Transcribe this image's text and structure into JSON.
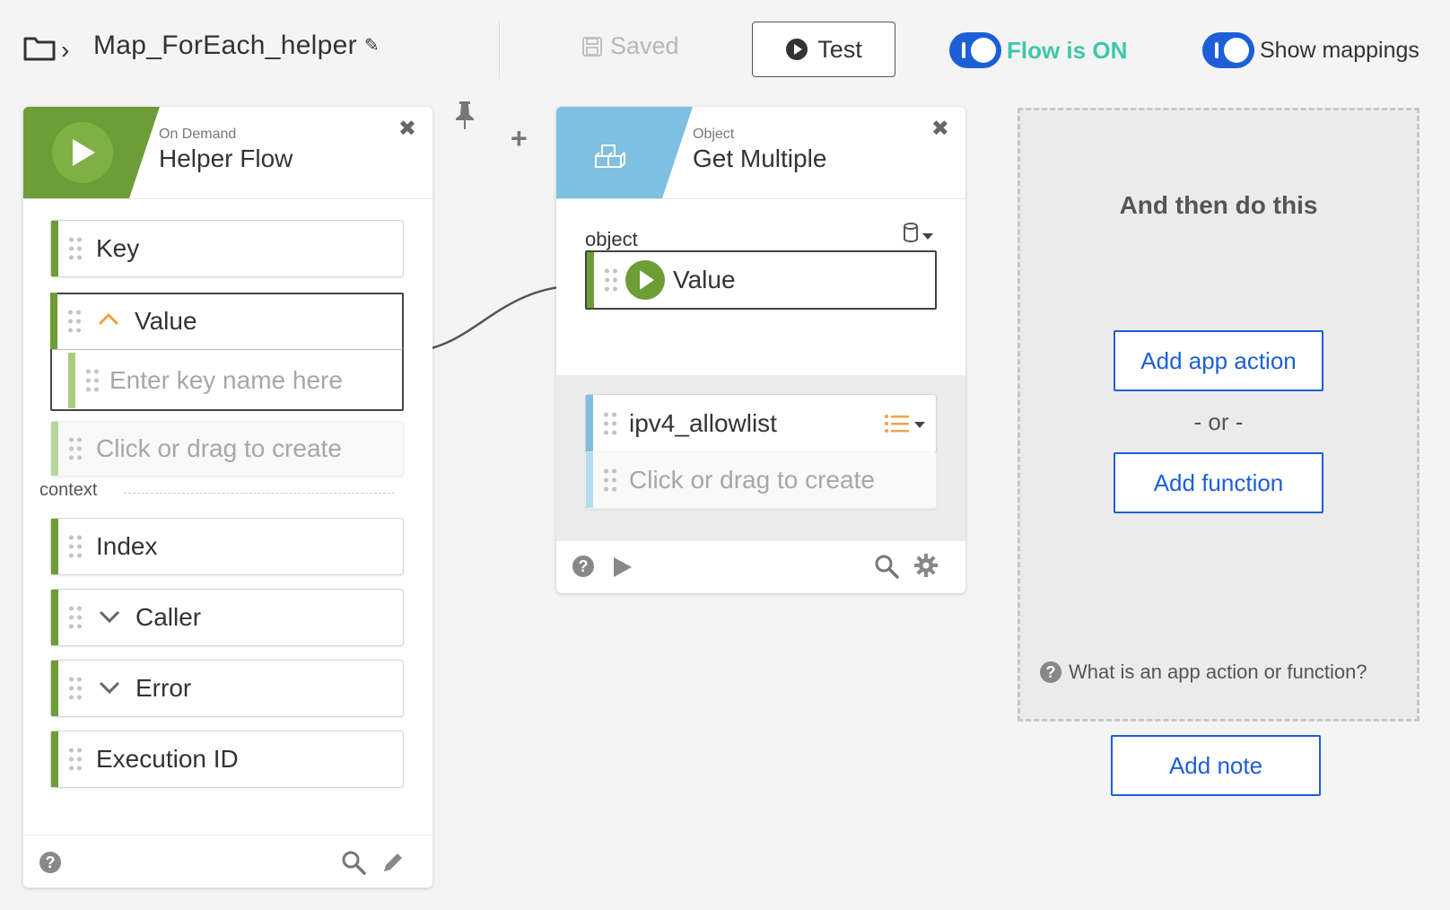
{
  "header": {
    "flow_name": "Map_ForEach_helper",
    "saved_label": "Saved",
    "test_label": "Test",
    "flow_status_label": "Flow is ON",
    "mappings_label": "Show mappings"
  },
  "trigger_card": {
    "subtitle": "On Demand",
    "title": "Helper Flow",
    "fields": [
      {
        "label": "Key"
      },
      {
        "label": "Value"
      },
      {
        "label": "Enter key name here"
      },
      {
        "label": "Click or drag to create"
      }
    ],
    "context_label": "context",
    "context_fields": [
      {
        "label": "Index"
      },
      {
        "label": "Caller"
      },
      {
        "label": "Error"
      },
      {
        "label": "Execution ID"
      }
    ]
  },
  "action_card": {
    "subtitle": "Object",
    "title": "Get Multiple",
    "input_label": "object",
    "input_value": "Value",
    "outputs": [
      {
        "label": "ipv4_allowlist"
      },
      {
        "label": "Click or drag to create"
      }
    ]
  },
  "next_panel": {
    "title": "And then do this",
    "add_app_action": "Add app action",
    "or_label": "- or -",
    "add_function": "Add function",
    "help_text": "What is an app action or function?"
  },
  "add_note_label": "Add note",
  "colors": {
    "trigger_green": "#6d9d36",
    "action_blue": "#7fbfe0",
    "brand_blue": "#1d5fd6",
    "status_teal": "#3ec8a8",
    "chevron_orange": "#f0a24a"
  }
}
